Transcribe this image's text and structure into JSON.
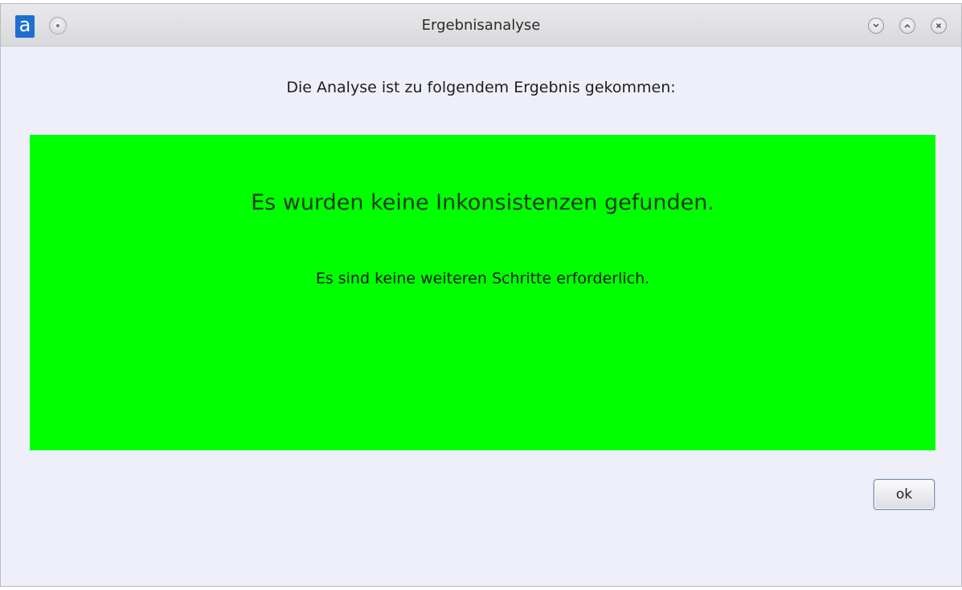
{
  "window": {
    "title": "Ergebnisanalyse",
    "app_icon_letter": "a",
    "icons": {
      "app": "app-logo-icon",
      "menu": "window-menu-icon",
      "minimize": "minimize-icon",
      "maximize": "maximize-icon",
      "close": "close-icon"
    }
  },
  "dialog": {
    "intro_text": "Die Analyse ist zu folgendem Ergebnis gekommen:",
    "result": {
      "message": "Es wurden keine Inkonsistenzen gefunden.",
      "detail": "Es sind keine weiteren Schritte erforderlich.",
      "status_color": "#00ff00"
    },
    "ok_label": "ok"
  }
}
